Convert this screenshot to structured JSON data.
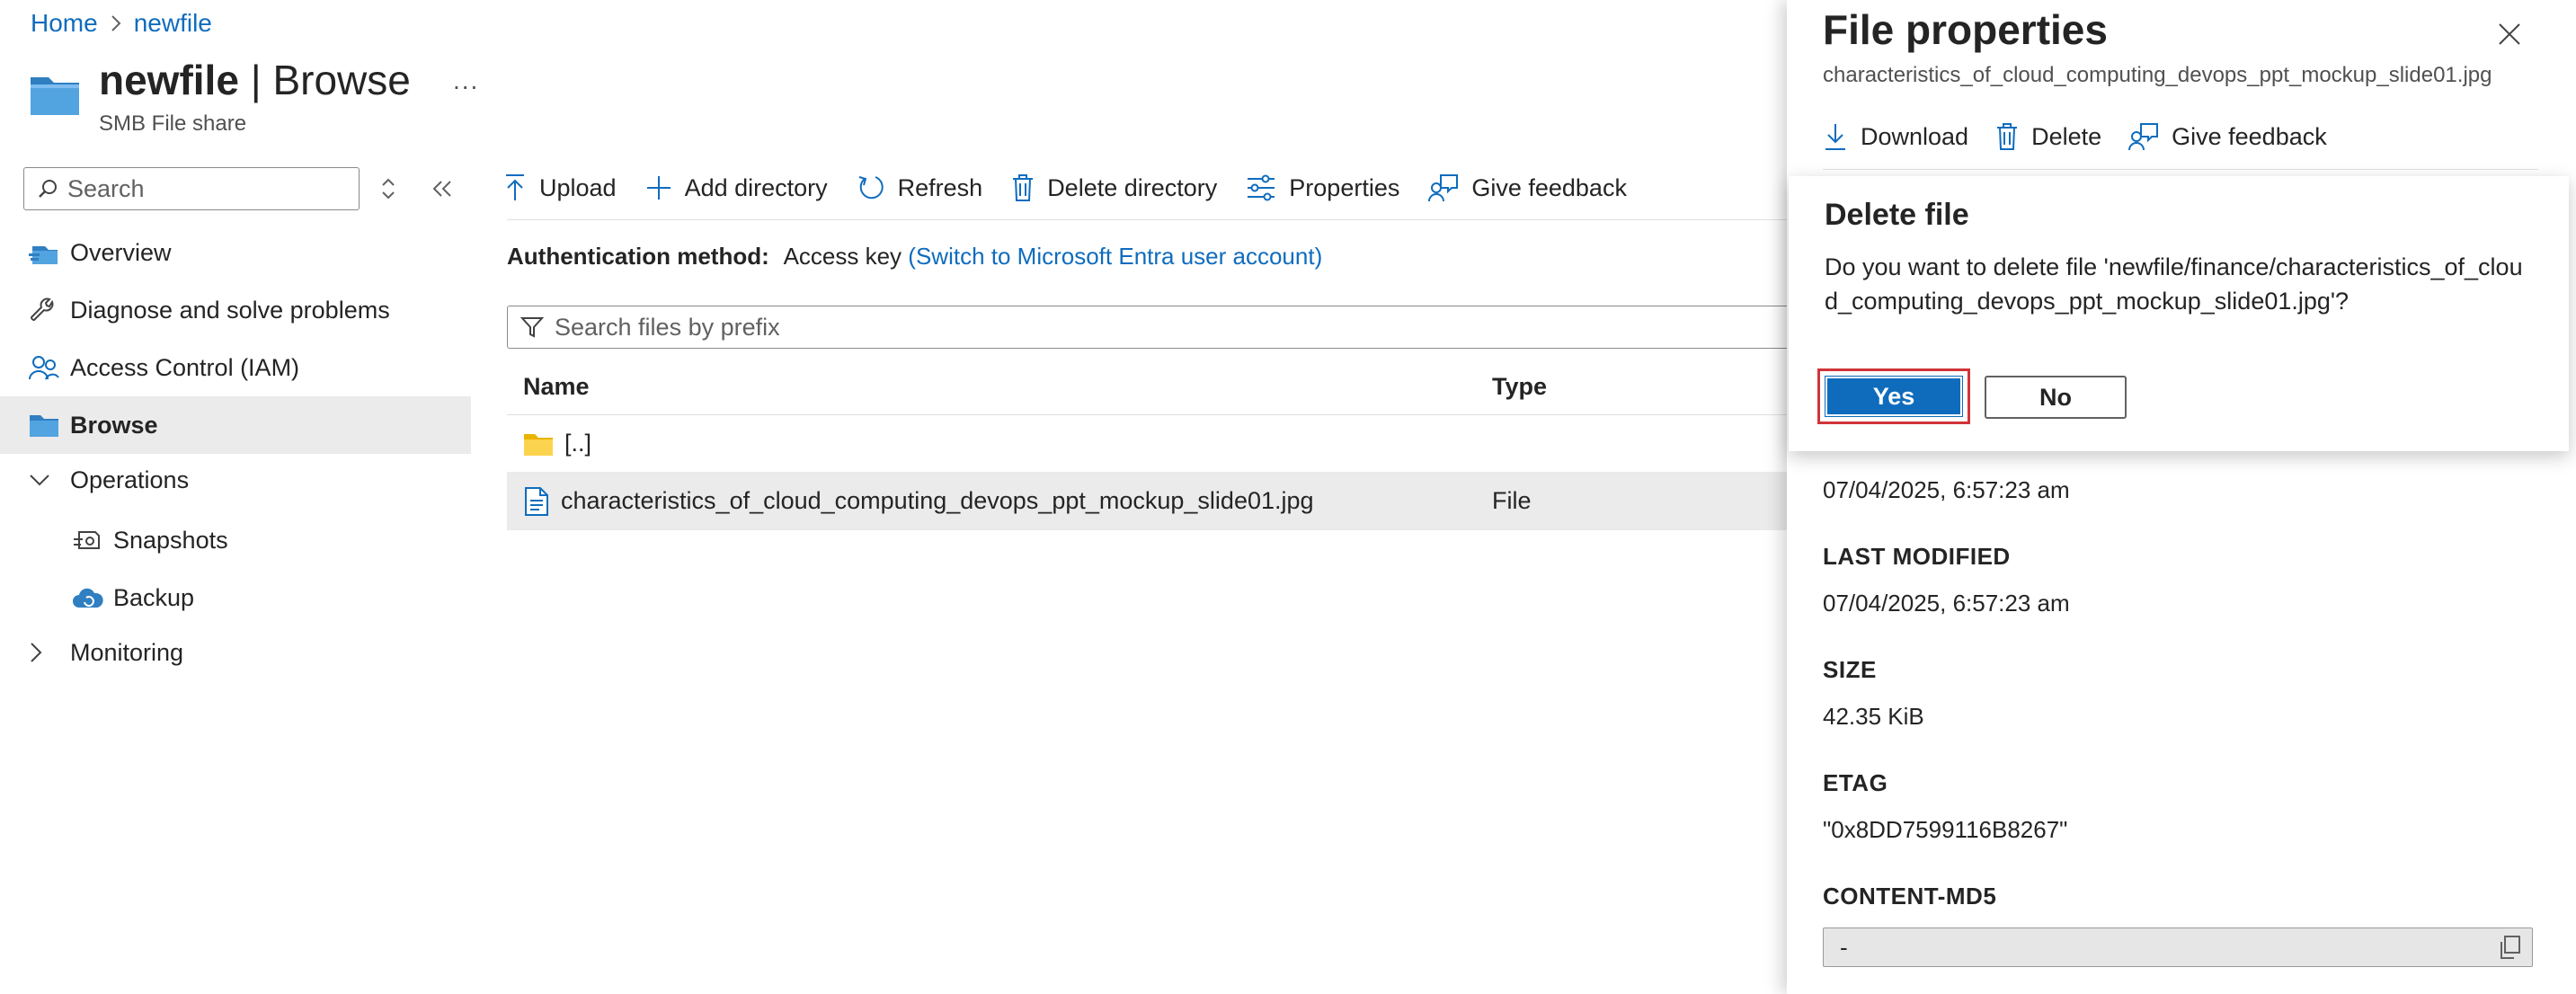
{
  "breadcrumb": {
    "home": "Home",
    "current": "newfile"
  },
  "header": {
    "title_name": "newfile",
    "title_separator": " | ",
    "title_page": "Browse",
    "subtitle": "SMB File share",
    "more": "..."
  },
  "sidebar": {
    "search_placeholder": "Search",
    "items": [
      {
        "label": "Overview",
        "icon": "overview-icon"
      },
      {
        "label": "Diagnose and solve problems",
        "icon": "wrench-icon"
      },
      {
        "label": "Access Control (IAM)",
        "icon": "people-icon"
      },
      {
        "label": "Browse",
        "icon": "folder-icon",
        "active": true
      },
      {
        "label": "Operations",
        "icon": "chevron-down-icon"
      },
      {
        "label": "Snapshots",
        "icon": "snapshot-icon"
      },
      {
        "label": "Backup",
        "icon": "cloud-backup-icon"
      },
      {
        "label": "Monitoring",
        "icon": "chevron-right-icon"
      }
    ]
  },
  "toolbar": {
    "upload": "Upload",
    "add_directory": "Add directory",
    "refresh": "Refresh",
    "delete_directory": "Delete directory",
    "properties": "Properties",
    "give_feedback": "Give feedback"
  },
  "auth": {
    "label": "Authentication method:",
    "value": "Access key",
    "switch_link": "(Switch to Microsoft Entra user account)"
  },
  "files": {
    "filter_placeholder": "Search files by prefix",
    "columns": {
      "name": "Name",
      "type": "Type"
    },
    "rows": [
      {
        "name": "[..]",
        "type": "",
        "icon": "folder-icon"
      },
      {
        "name": "characteristics_of_cloud_computing_devops_ppt_mockup_slide01.jpg",
        "type": "File",
        "icon": "file-icon"
      }
    ]
  },
  "panel": {
    "title": "File properties",
    "subtitle": "characteristics_of_cloud_computing_devops_ppt_mockup_slide01.jpg",
    "download": "Download",
    "delete": "Delete",
    "give_feedback": "Give feedback",
    "created_value": "07/04/2025, 6:57:23 am",
    "last_modified_label": "LAST MODIFIED",
    "last_modified_value": "07/04/2025, 6:57:23 am",
    "size_label": "SIZE",
    "size_value": "42.35 KiB",
    "etag_label": "ETAG",
    "etag_value": "\"0x8DD7599116B8267\"",
    "md5_label": "CONTENT-MD5",
    "md5_value": "-"
  },
  "dialog": {
    "title": "Delete file",
    "message": "Do you want to delete file 'newfile/finance/characteristics_of_cloud_computing_devops_ppt_mockup_slide01.jpg'?",
    "yes": "Yes",
    "no": "No"
  },
  "colors": {
    "accent": "#0f6cbd",
    "highlight_border": "#d13438",
    "selected_row": "#ebebeb"
  }
}
